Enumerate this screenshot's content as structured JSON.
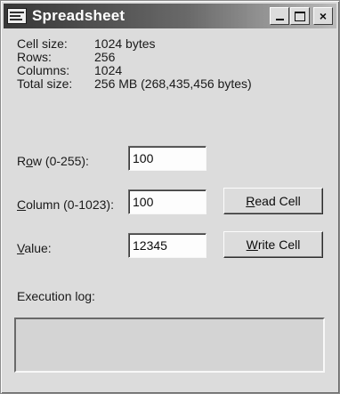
{
  "window": {
    "title": "Spreadsheet",
    "icon": "spreadsheet-app-icon",
    "controls": {
      "minimize": "",
      "maximize": "",
      "close": "×"
    }
  },
  "info": [
    {
      "label": "Cell size:",
      "value": "1024 bytes"
    },
    {
      "label": "Rows:",
      "value": "256"
    },
    {
      "label": "Columns:",
      "value": "1024"
    },
    {
      "label": "Total size:",
      "value": "256 MB (268,435,456 bytes)"
    }
  ],
  "form": {
    "row": {
      "label_pre": "R",
      "label_accel": "o",
      "label_post": "w (0-255):",
      "value": "100"
    },
    "column": {
      "label_pre": "",
      "label_accel": "C",
      "label_post": "olumn (0-1023):",
      "value": "100"
    },
    "value": {
      "label_pre": "",
      "label_accel": "V",
      "label_post": "alue:",
      "value": "12345"
    }
  },
  "buttons": {
    "read": {
      "accel": "R",
      "rest": "ead Cell"
    },
    "write": {
      "accel": "W",
      "rest": "rite Cell"
    }
  },
  "log": {
    "label": "Execution log:"
  }
}
